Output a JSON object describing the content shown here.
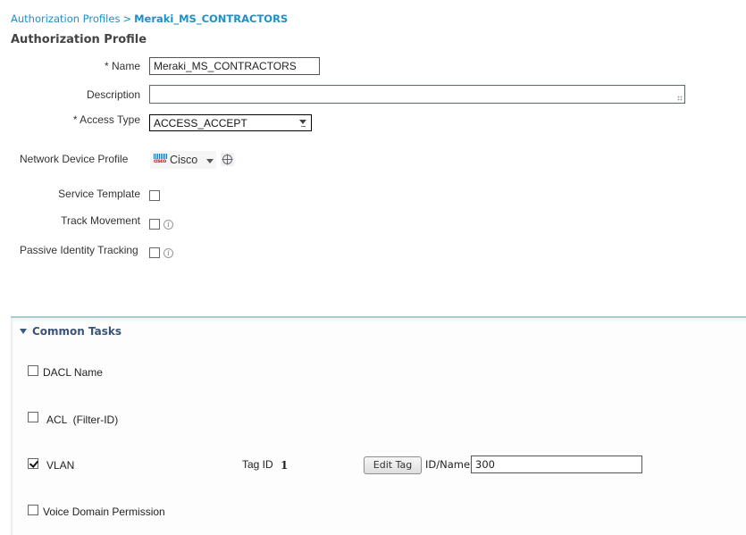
{
  "breadcrumb": {
    "parent": "Authorization Profiles",
    "separator": ">",
    "current": "Meraki_MS_CONTRACTORS"
  },
  "page_title": "Authorization Profile",
  "form": {
    "name": {
      "label": "* Name",
      "value": "Meraki_MS_CONTRACTORS"
    },
    "description": {
      "label": "Description",
      "value": ""
    },
    "access_type": {
      "label": "* Access Type",
      "selected": "ACCESS_ACCEPT"
    },
    "network_device_profile": {
      "label": "Network Device Profile",
      "selected": "Cisco",
      "logo_text": "cisco",
      "icon": "cisco-logo-icon",
      "action_icon": "target-crosshair-icon"
    },
    "service_template": {
      "label": "Service Template",
      "checked": false
    },
    "track_movement": {
      "label": "Track Movement",
      "checked": false,
      "info_icon": "i"
    },
    "passive_identity_tracking": {
      "label": "Passive Identity Tracking",
      "checked": false,
      "info_icon": "i"
    }
  },
  "common_tasks": {
    "title": "Common Tasks",
    "expanded": true,
    "items": [
      {
        "label": "DACL Name",
        "checked": false
      },
      {
        "label": "ACL  (Filter-ID)",
        "checked": false
      },
      {
        "label": "VLAN",
        "checked": true,
        "tag_id_label": "Tag ID",
        "tag_id_value": "1",
        "edit_tag_label": "Edit Tag",
        "id_name_label": "ID/Name",
        "id_name_value": "300"
      },
      {
        "label": "Voice Domain Permission",
        "checked": false
      }
    ]
  }
}
